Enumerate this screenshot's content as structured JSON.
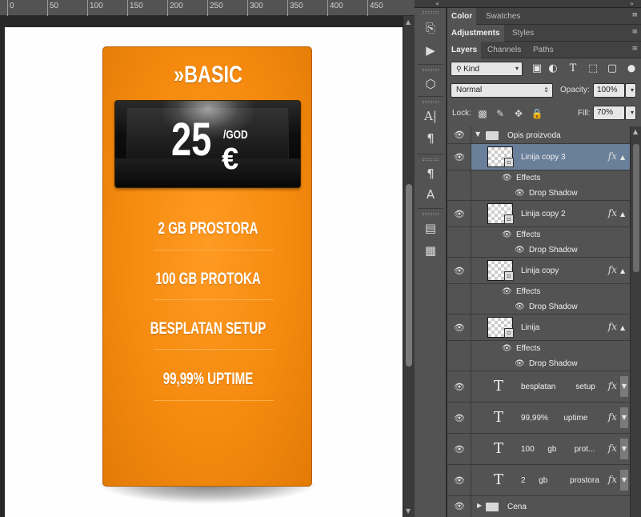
{
  "ruler": {
    "labels": [
      "0",
      "50",
      "100",
      "150",
      "200",
      "250",
      "300",
      "350",
      "400",
      "450"
    ]
  },
  "card": {
    "plan": "»BASIC",
    "price_amount": "25",
    "price_period": "/GOD",
    "price_currency": "€",
    "features": [
      "2 GB PROSTORA",
      "100 GB PROTOKA",
      "BESPLATAN SETUP",
      "99,99% UPTIME"
    ]
  },
  "panel_tabs": {
    "row1": [
      "Color",
      "Swatches"
    ],
    "row2": [
      "Adjustments",
      "Styles"
    ],
    "row3": [
      "Layers",
      "Channels",
      "Paths"
    ]
  },
  "layers_panel": {
    "filter_kind": "Kind",
    "blend_mode": "Normal",
    "opacity_label": "Opacity:",
    "opacity_value": "100%",
    "lock_label": "Lock:",
    "fill_label": "Fill:",
    "fill_value": "70%"
  },
  "layers": {
    "group": "Opis proizvoda",
    "effects_label": "Effects",
    "drop_shadow_label": "Drop Shadow",
    "smart_layers": [
      "Linija copy 3",
      "Linija copy 2",
      "Linija copy",
      "Linija"
    ],
    "text_layers": [
      "besplatan         setup",
      "99,99%       uptime",
      "100      gb        prot...",
      "2      gb          prostora"
    ],
    "bottom_group": "Cena"
  },
  "icons": {
    "eye": "eye-icon",
    "fx": "fx",
    "type": "T",
    "collapse": "«"
  }
}
